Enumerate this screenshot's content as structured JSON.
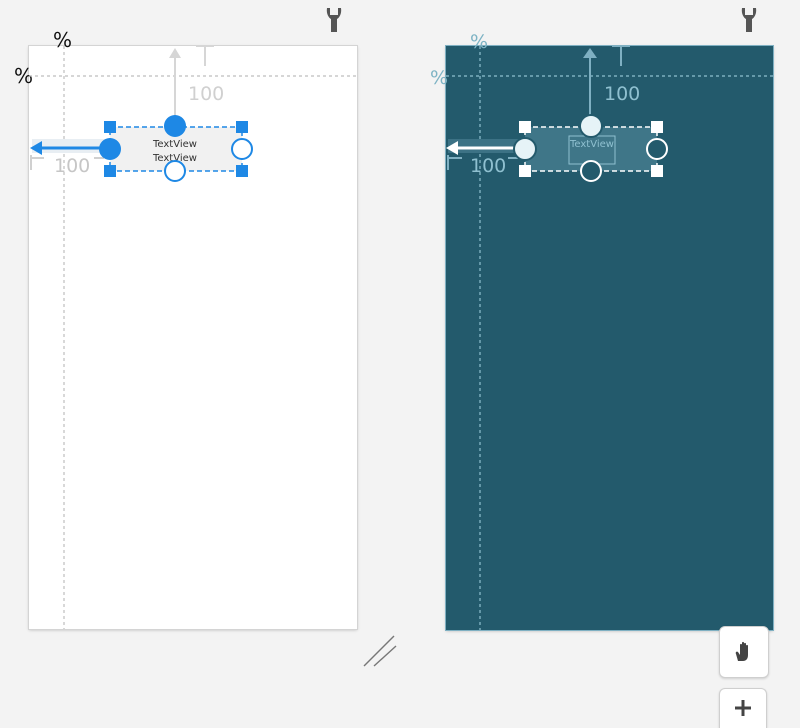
{
  "design_view": {
    "guideline_percent_vertical": "%",
    "guideline_percent_horizontal": "%",
    "textview_label": "TextView",
    "textview_label_ghost": "TextView",
    "margin_top": "100",
    "margin_start": "100",
    "settings_icon": "wrench-icon"
  },
  "blueprint_view": {
    "guideline_percent_vertical": "%",
    "guideline_percent_horizontal": "%",
    "textview_label": "TextView",
    "margin_top": "100",
    "margin_start": "100",
    "settings_icon": "wrench-icon"
  },
  "tools": {
    "pan_icon": "hand-icon",
    "zoom_in_icon": "plus-icon",
    "resize_icon": "resize-grip-icon"
  },
  "colors": {
    "selection_blue": "#1e88e5",
    "blueprint_bg": "#235a6c",
    "guideline": "#b8b8b8",
    "constraint_gray": "#d0d0d0"
  }
}
